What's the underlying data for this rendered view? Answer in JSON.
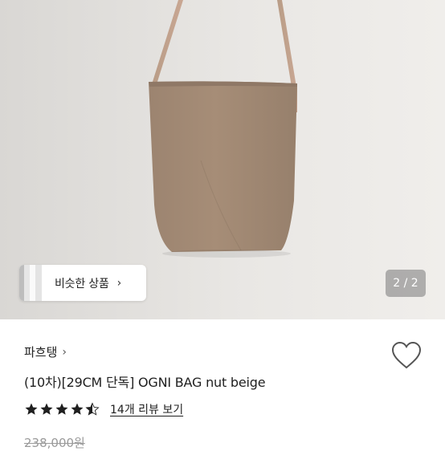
{
  "product_image": {
    "alt_subject": "bag-photo",
    "similar_products": {
      "label": "비슷한 상품",
      "chevron": "chevron-right-icon"
    },
    "pagination": {
      "text": "2 / 2",
      "current": 2,
      "total": 2
    }
  },
  "seller": {
    "name": "파흐탱",
    "chevron": "chevron-right-icon"
  },
  "product": {
    "title": "(10차)[29CM 단독] OGNI BAG nut beige",
    "rating": 4.5,
    "rating_max": 5,
    "review_link": "14개 리뷰 보기",
    "price": "238,000원"
  },
  "icons": {
    "favorite": "heart-icon",
    "star": "star-icon"
  },
  "colors": {
    "bag": "#a48a74",
    "background": "#ebe9e6",
    "star": "#1f1f1f",
    "heart_outline": "#555555"
  }
}
